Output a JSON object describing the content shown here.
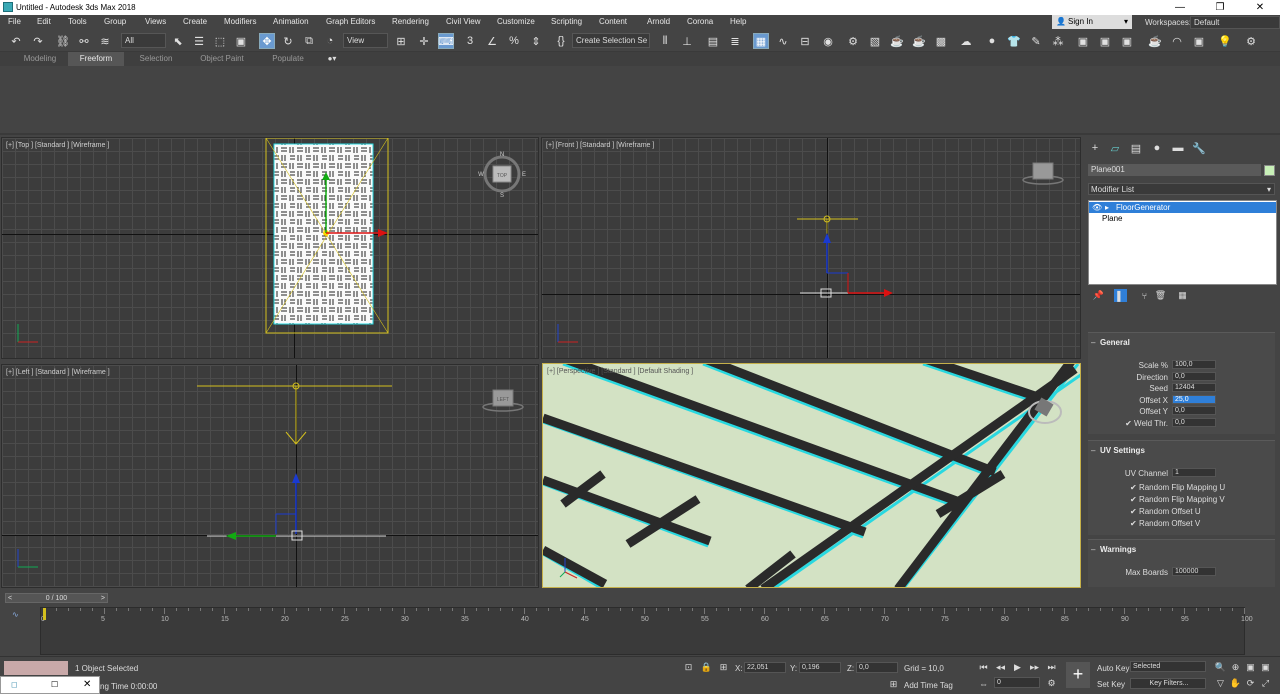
{
  "window": {
    "title": "Untitled - Autodesk 3ds Max 2018",
    "minimize": "—",
    "restore": "❐",
    "close": "✕"
  },
  "menu": [
    "File",
    "Edit",
    "Tools",
    "Group",
    "Views",
    "Create",
    "Modifiers",
    "Animation",
    "Graph Editors",
    "Rendering",
    "Civil View",
    "Customize",
    "Scripting",
    "Content",
    "Arnold",
    "Corona",
    "Help"
  ],
  "account": {
    "signin": "Sign In",
    "workspaces_label": "Workspaces:",
    "workspace": "Default"
  },
  "toolbar": {
    "filter": "All",
    "ref_coord": "View",
    "selection_set": "Create Selection Se"
  },
  "ribbon": {
    "tabs": [
      "Modeling",
      "Freeform",
      "Selection",
      "Object Paint",
      "Populate"
    ],
    "active": "Freeform"
  },
  "viewports": {
    "top": "[+] [Top ] [Standard ] [Wireframe ]",
    "front": "[+] [Front ] [Standard ] [Wireframe ]",
    "left": "[+] [Left ] [Standard ] [Wireframe ]",
    "perspective": "[+] [Perspective ] [Standard ] [Default Shading ]",
    "viewcube_top": "TOP",
    "viewcube_left": "LEFT",
    "compass": {
      "n": "N",
      "s": "S",
      "e": "E",
      "w": "W"
    }
  },
  "command_panel": {
    "object_name": "Plane001",
    "modifier_list": "Modifier List",
    "stack": [
      "FloorGenerator",
      "Plane"
    ],
    "general": {
      "title": "General",
      "params": [
        {
          "label": "Scale %",
          "value": "100,0"
        },
        {
          "label": "Direction",
          "value": "0,0"
        },
        {
          "label": "Seed",
          "value": "12404"
        },
        {
          "label": "Offset X",
          "value": "25,0"
        },
        {
          "label": "Offset Y",
          "value": "0,0"
        },
        {
          "label": "Weld Thr.",
          "value": "0,0"
        }
      ]
    },
    "uv_settings": {
      "title": "UV Settings",
      "uv_channel_label": "UV Channel",
      "uv_channel": "1",
      "checks": [
        "Random Flip Mapping U",
        "Random Flip Mapping V",
        "Random Offset U",
        "Random Offset V"
      ]
    },
    "warnings": {
      "title": "Warnings",
      "max_boards_label": "Max Boards",
      "max_boards": "100000"
    }
  },
  "timeline": {
    "frame": "0 / 100",
    "ticks": [
      "0",
      "5",
      "10",
      "15",
      "20",
      "25",
      "30",
      "35",
      "40",
      "45",
      "50",
      "55",
      "60",
      "65",
      "70",
      "75",
      "80",
      "85",
      "90",
      "95",
      "100"
    ]
  },
  "status": {
    "selected": "1 Object Selected",
    "time": "ng Time  0:00:00",
    "x": "22,051",
    "y": "0,196",
    "z": "0,0",
    "grid": "Grid = 10,0",
    "add_time_tag": "Add Time Tag",
    "auto_key": "Auto Key",
    "set_key": "Set Key",
    "key_mode": "Selected",
    "key_filters": "Key Filters...",
    "current_frame": "0"
  },
  "colors": {
    "accent": "#2f7fd8",
    "persp_floor": "#d3e2c4",
    "persp_gap": "#2a2a2a",
    "edge": "#28d8e0",
    "selection": "#d4c01e"
  }
}
